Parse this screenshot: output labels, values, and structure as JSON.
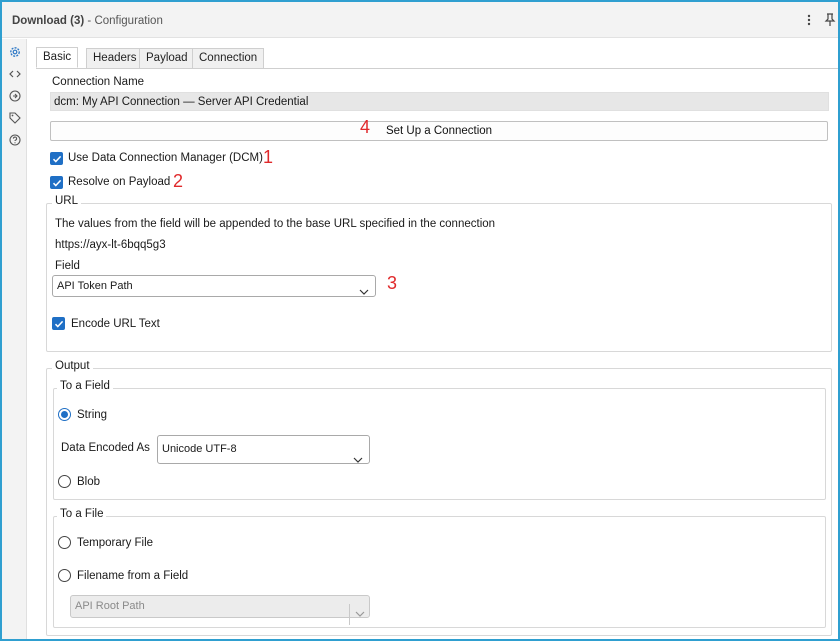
{
  "window": {
    "title": "Download (3)",
    "title_sep": " - ",
    "subtitle": "Configuration"
  },
  "titlebar_icons": [
    "more-vertical-icon",
    "pin-icon"
  ],
  "sidebar_icons": [
    "gear-icon",
    "code-icon",
    "link-icon",
    "tag-icon",
    "help-icon"
  ],
  "tabs": [
    {
      "label": "Basic",
      "active": true
    },
    {
      "label": "Headers",
      "active": false
    },
    {
      "label": "Payload",
      "active": false
    },
    {
      "label": "Connection",
      "active": false
    }
  ],
  "basic": {
    "connection_name_label": "Connection Name",
    "connection_name_value": "dcm: My API Connection — Server API Credential",
    "setup_button": "Set Up a Connection",
    "use_dcm_label": "Use Data Connection Manager (DCM)",
    "use_dcm_checked": true,
    "resolve_payload_label": "Resolve on Payload",
    "resolve_payload_checked": true
  },
  "annotations": {
    "one": "1",
    "two": "2",
    "three": "3",
    "four": "4"
  },
  "url": {
    "group_title": "URL",
    "description": "The values from the field will be appended to the base URL specified in the connection",
    "base_url": "https://ayx-lt-6bqq5g3",
    "field_label": "Field",
    "field_value": "API Token Path",
    "encode_label": "Encode URL Text",
    "encode_checked": true
  },
  "output": {
    "group_title": "Output",
    "to_field": {
      "title": "To a Field",
      "string_label": "String",
      "string_selected": true,
      "encoded_as_label": "Data Encoded As",
      "encoded_as_value": "Unicode UTF-8",
      "blob_label": "Blob",
      "blob_selected": false
    },
    "to_file": {
      "title": "To a File",
      "temp_label": "Temporary File",
      "temp_selected": false,
      "filename_label": "Filename from a Field",
      "filename_selected": false,
      "filename_field_value": "API Root Path"
    }
  },
  "colors": {
    "accent": "#1f6fc5",
    "annotation": "#e0292b",
    "frame": "#2f9fd0"
  }
}
